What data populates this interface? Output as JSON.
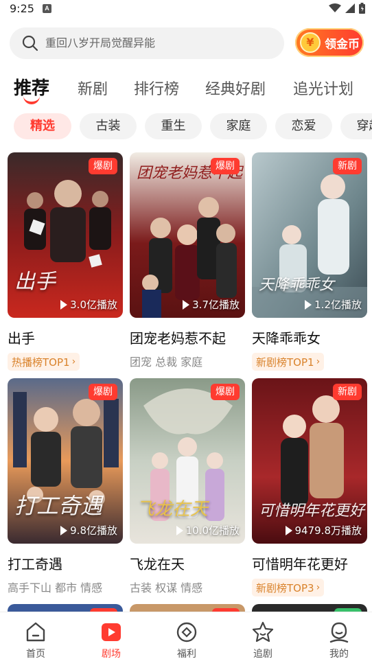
{
  "status_bar": {
    "time": "9:25",
    "notif_glyph": "A"
  },
  "search": {
    "placeholder": "重回八岁开局觉醒异能",
    "coin_label": "领金币",
    "coin_glyph": "¥"
  },
  "tabs": [
    {
      "label": "推荐"
    },
    {
      "label": "新剧"
    },
    {
      "label": "排行榜"
    },
    {
      "label": "经典好剧"
    },
    {
      "label": "追光计划"
    }
  ],
  "chips": [
    {
      "label": "精选"
    },
    {
      "label": "古装"
    },
    {
      "label": "重生"
    },
    {
      "label": "家庭"
    },
    {
      "label": "恋爱"
    },
    {
      "label": "穿越"
    }
  ],
  "cards": [
    {
      "title": "出手",
      "badge": "爆剧",
      "plays": "3.0亿播放",
      "art_text": "出手",
      "rank": "热播榜TOP1",
      "tags": ""
    },
    {
      "title": "团宠老妈惹不起",
      "badge": "爆剧",
      "plays": "3.7亿播放",
      "art_text": "团宠老妈惹不起",
      "rank": "",
      "tags": "团宠 总裁 家庭"
    },
    {
      "title": "天降乖乖女",
      "badge": "新剧",
      "plays": "1.2亿播放",
      "art_text": "天降乖乖女",
      "rank": "新剧榜TOP1",
      "tags": ""
    },
    {
      "title": "打工奇遇",
      "badge": "爆剧",
      "plays": "9.8亿播放",
      "art_text": "打工奇遇",
      "rank": "",
      "tags": "高手下山 都市 情感"
    },
    {
      "title": "飞龙在天",
      "badge": "爆剧",
      "plays": "10.0亿播放",
      "art_text": "飞龙在天",
      "rank": "",
      "tags": "古装 权谋 情感"
    },
    {
      "title": "可惜明年花更好",
      "badge": "新剧",
      "plays": "9479.8万播放",
      "art_text": "可惜明年花更好",
      "rank": "新剧榜TOP3",
      "tags": ""
    }
  ],
  "bottom_nav": [
    {
      "label": "首页",
      "icon": "home-icon"
    },
    {
      "label": "剧场",
      "icon": "theater-play-icon"
    },
    {
      "label": "福利",
      "icon": "welfare-icon"
    },
    {
      "label": "追剧",
      "icon": "star-follow-icon"
    },
    {
      "label": "我的",
      "icon": "profile-icon"
    }
  ],
  "colors": {
    "accent": "#ff3b30",
    "coin_gradient_start": "#ff7a22",
    "rank_text": "#d9822b"
  }
}
